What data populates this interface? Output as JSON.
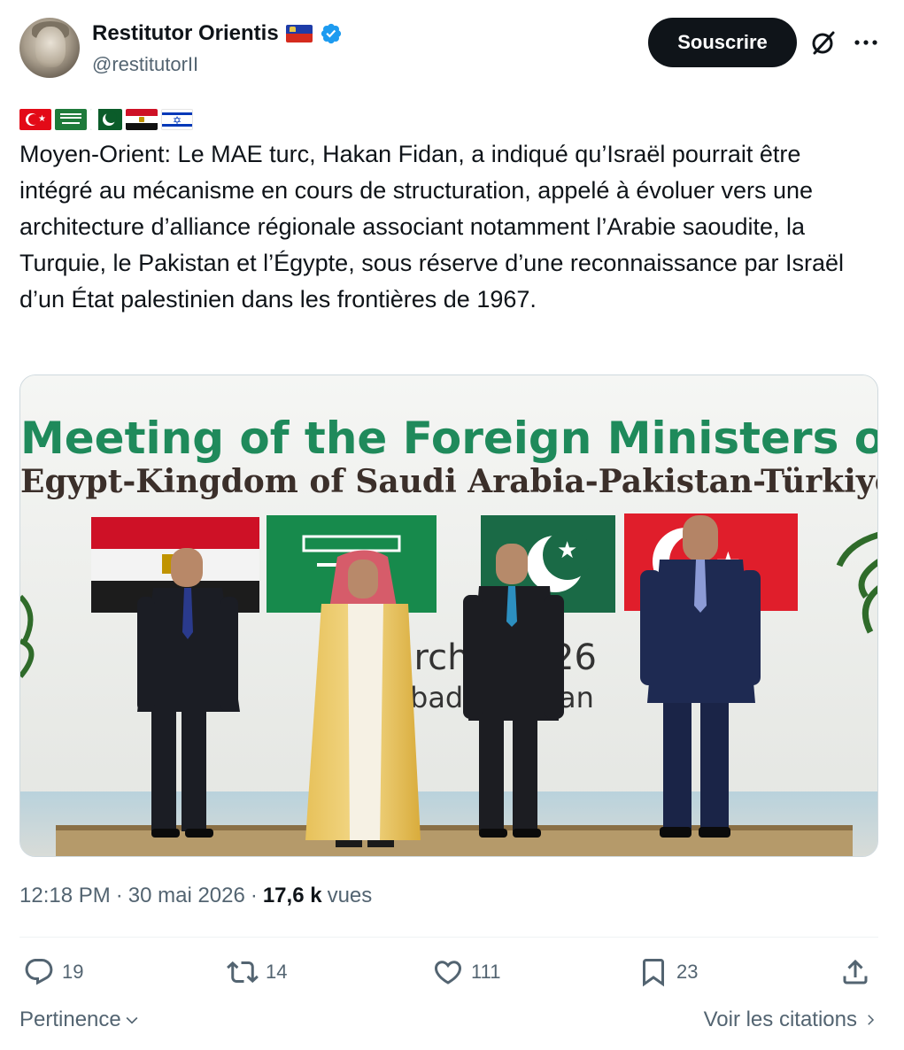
{
  "author": {
    "display_name": "Restitutor Orientis",
    "handle": "@restitutorII",
    "verified": true
  },
  "header": {
    "subscribe_label": "Souscrire",
    "grok_icon": "grok-slash-icon",
    "more_icon": "more-horizontal-icon"
  },
  "tweet": {
    "flags": [
      "turkey-flag",
      "saudi-arabia-flag",
      "pakistan-flag",
      "egypt-flag",
      "israel-flag"
    ],
    "text": "Moyen-Orient: Le MAE turc, Hakan Fidan, a indiqué qu’Israël pourrait être intégré au mécanisme en cours de structuration, appelé à évoluer vers une architecture d’alliance régionale associant notamment l’Arabie saoudite, la Turquie, le Pakistan et l’Égypte, sous réserve d’une reconnaissance par Israël d’un État palestinien dans les frontières de 1967.",
    "media": {
      "banner_line1": "Meeting of the Foreign Ministers of",
      "banner_line2": "Egypt-Kingdom of Saudi Arabia-Pakistan-Türkiye",
      "backdrop_fragment_1": "arch",
      "backdrop_fragment_2": "26",
      "backdrop_fragment_3": "bad-",
      "backdrop_fragment_4": "an"
    }
  },
  "meta": {
    "time": "12:18 PM",
    "separator": "·",
    "date": "30 mai 2026",
    "separator2": "·",
    "views_count": "17,6 k",
    "views_label": "vues"
  },
  "actions": {
    "replies": "19",
    "reposts": "14",
    "likes": "111",
    "bookmarks": "23"
  },
  "footer": {
    "sort_label": "Pertinence",
    "quotes_label": "Voir les citations"
  },
  "colors": {
    "text_primary": "#0f1419",
    "text_secondary": "#536471",
    "verified_blue": "#1d9bf0",
    "banner_green": "#1f8a5b",
    "banner_dark": "#3b2f2a"
  }
}
